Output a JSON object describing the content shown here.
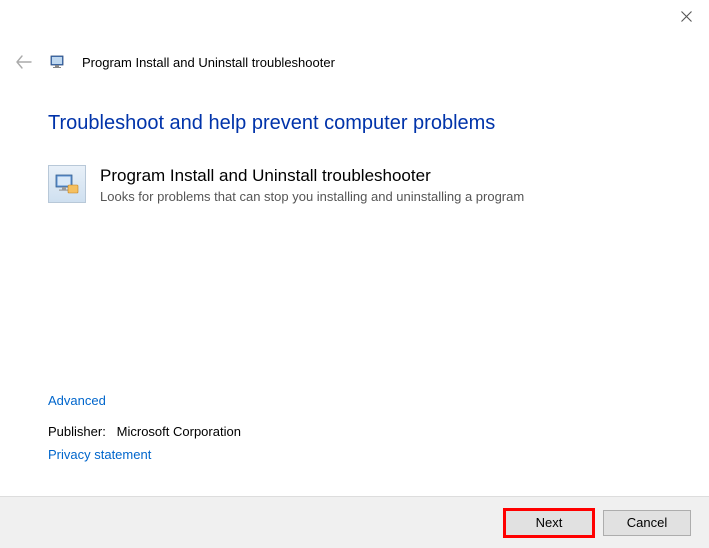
{
  "titlebar": {
    "close_label": "Close"
  },
  "header": {
    "window_title": "Program Install and Uninstall troubleshooter"
  },
  "content": {
    "heading": "Troubleshoot and help prevent computer problems",
    "trouble_title": "Program Install and Uninstall troubleshooter",
    "trouble_desc": "Looks for problems that can stop you installing and uninstalling a program"
  },
  "links": {
    "advanced": "Advanced",
    "publisher_label": "Publisher:",
    "publisher_value": "Microsoft Corporation",
    "privacy": "Privacy statement"
  },
  "footer": {
    "next": "Next",
    "cancel": "Cancel"
  }
}
